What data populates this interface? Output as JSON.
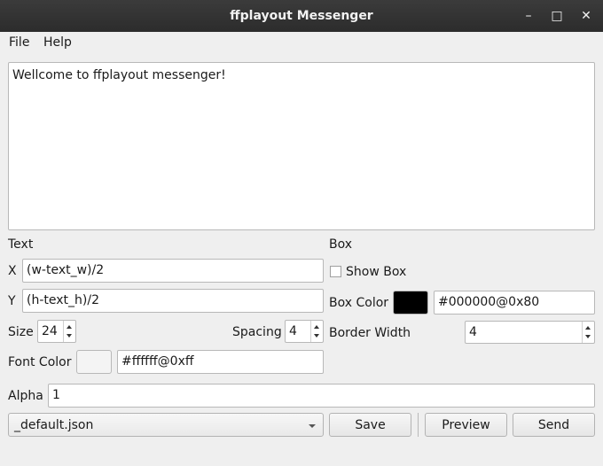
{
  "window": {
    "title": "ffplayout Messenger",
    "minimize_glyph": "–",
    "maximize_glyph": "□",
    "close_glyph": "✕"
  },
  "menu": {
    "file": "File",
    "help": "Help"
  },
  "message": "Wellcome to ffplayout messenger!",
  "text_section": {
    "heading": "Text",
    "x_label": "X",
    "x_value": "(w-text_w)/2",
    "y_label": "Y",
    "y_value": "(h-text_h)/2",
    "size_label": "Size",
    "size_value": "24",
    "spacing_label": "Spacing",
    "spacing_value": "4",
    "font_color_label": "Font Color",
    "font_color_swatch": "#f4f4f4",
    "font_color_value": "#ffffff@0xff"
  },
  "box_section": {
    "heading": "Box",
    "show_box_label": "Show Box",
    "show_box_checked": false,
    "box_color_label": "Box Color",
    "box_color_swatch": "#000000",
    "box_color_value": "#000000@0x80",
    "border_width_label": "Border Width",
    "border_width_value": "4"
  },
  "alpha": {
    "label": "Alpha",
    "value": "1"
  },
  "preset": {
    "selected": "_default.json"
  },
  "buttons": {
    "save": "Save",
    "preview": "Preview",
    "send": "Send"
  }
}
